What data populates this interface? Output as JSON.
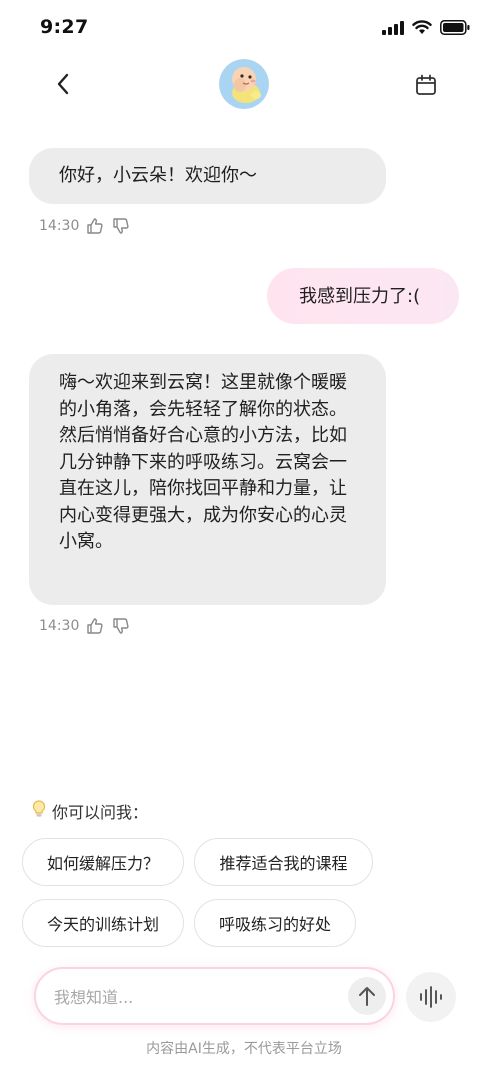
{
  "status_bar": {
    "time": "9:27",
    "icons": [
      "signal-icon",
      "wifi-icon",
      "battery-icon"
    ]
  },
  "nav": {
    "back_icon": "chevron-left-icon",
    "avatar": "baby-avatar",
    "calendar_icon": "calendar-icon"
  },
  "messages": [
    {
      "role": "assistant",
      "text": "你好，小云朵！欢迎你～",
      "time": "14:30"
    },
    {
      "role": "user",
      "text": "我感到压力了:("
    },
    {
      "role": "assistant",
      "text": "嗨～欢迎来到云窝！这里就像个暖暖的小角落，会先轻轻了解你的状态。然后悄悄备好合心意的小方法，比如几分钟静下来的呼吸练习。云窝会一直在这儿，陪你找回平静和力量，让内心变得更强大，成为你安心的心灵小窝。",
      "time": "14:30"
    }
  ],
  "suggestions": {
    "header": "你可以问我：",
    "items": [
      "如何缓解压力？",
      "推荐适合我的课程",
      "今天的训练计划",
      "呼吸练习的好处"
    ]
  },
  "input": {
    "placeholder": "我想知道...",
    "value": ""
  },
  "disclaimer": "内容由AI生成，不代表平台立场",
  "colors": {
    "ai_bubble": "#ececec",
    "user_bubble": "#ffe4ef",
    "input_border": "#fbd3e3",
    "avatar_bg": "#a9d4f2"
  }
}
